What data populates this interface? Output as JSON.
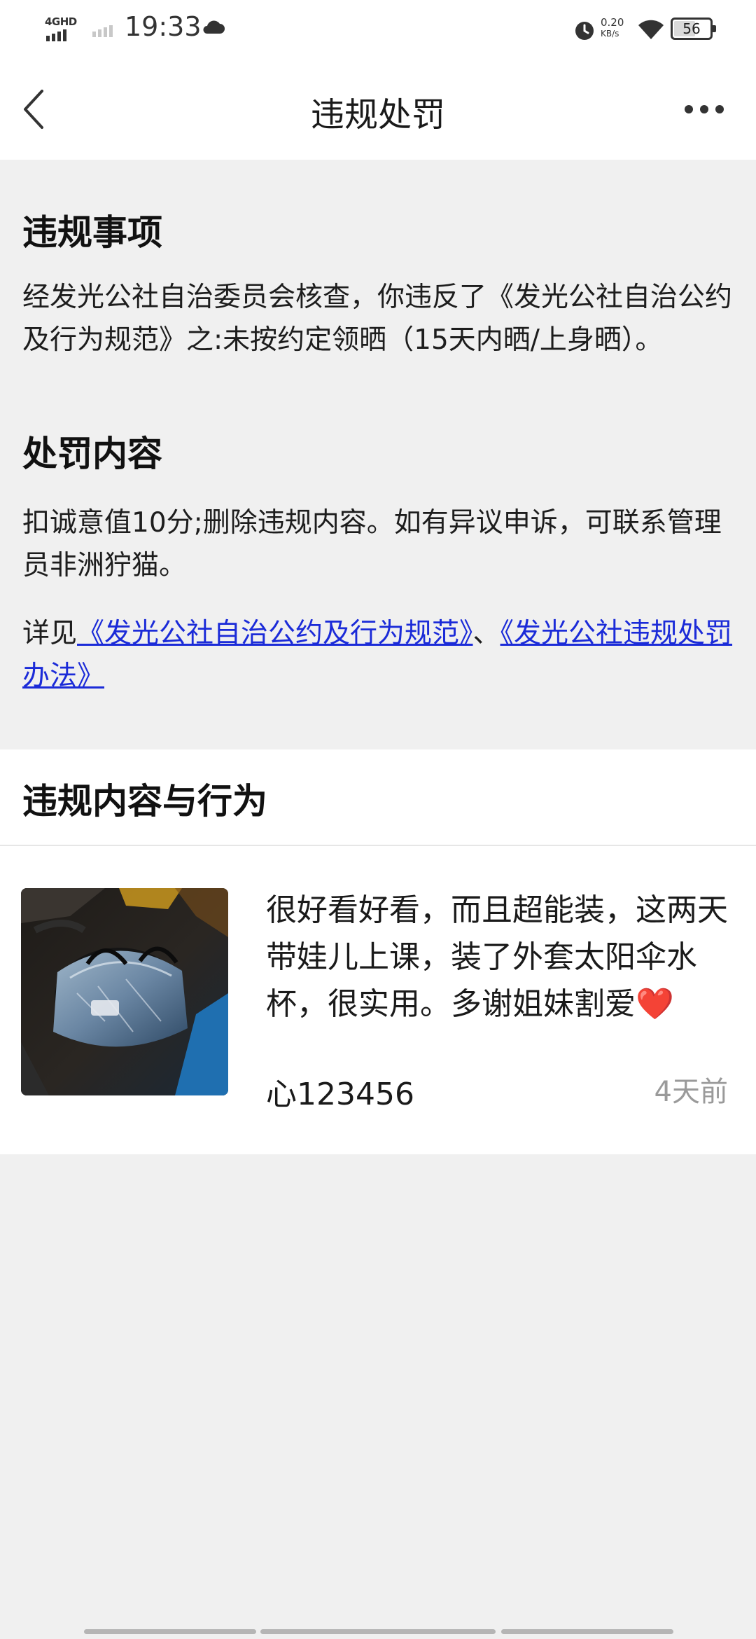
{
  "status_bar": {
    "network": "4GHD",
    "time": "19:33",
    "speed_value": "0.20",
    "speed_unit": "KB/s",
    "battery": "56"
  },
  "nav": {
    "title": "违规处罚"
  },
  "violation": {
    "heading": "违规事项",
    "text": "经发光公社自治委员会核查，你违反了《发光公社自治公约及行为规范》之:未按约定领晒（15天内晒/上身晒）。",
    "penalty_heading": "处罚内容",
    "penalty_text": "扣诚意值10分;删除违规内容。如有异议申诉，可联系管理员非洲狞猫。",
    "see_prefix": "详见",
    "link1": "《发光公社自治公约及行为规范》",
    "separator": "、",
    "link2": "《发光公社违规处罚办法》"
  },
  "content_section": {
    "heading": "违规内容与行为",
    "post": {
      "text": "很好看好看，而且超能装，这两天带娃儿上课，装了外套太阳伞水杯，很实用。多谢姐妹割爱",
      "emoji": "❤️",
      "username": "心123456",
      "time": "4天前"
    }
  },
  "colors": {
    "link": "#1b2bd8",
    "heart": "#e0242c",
    "background": "#f0f0f0"
  }
}
